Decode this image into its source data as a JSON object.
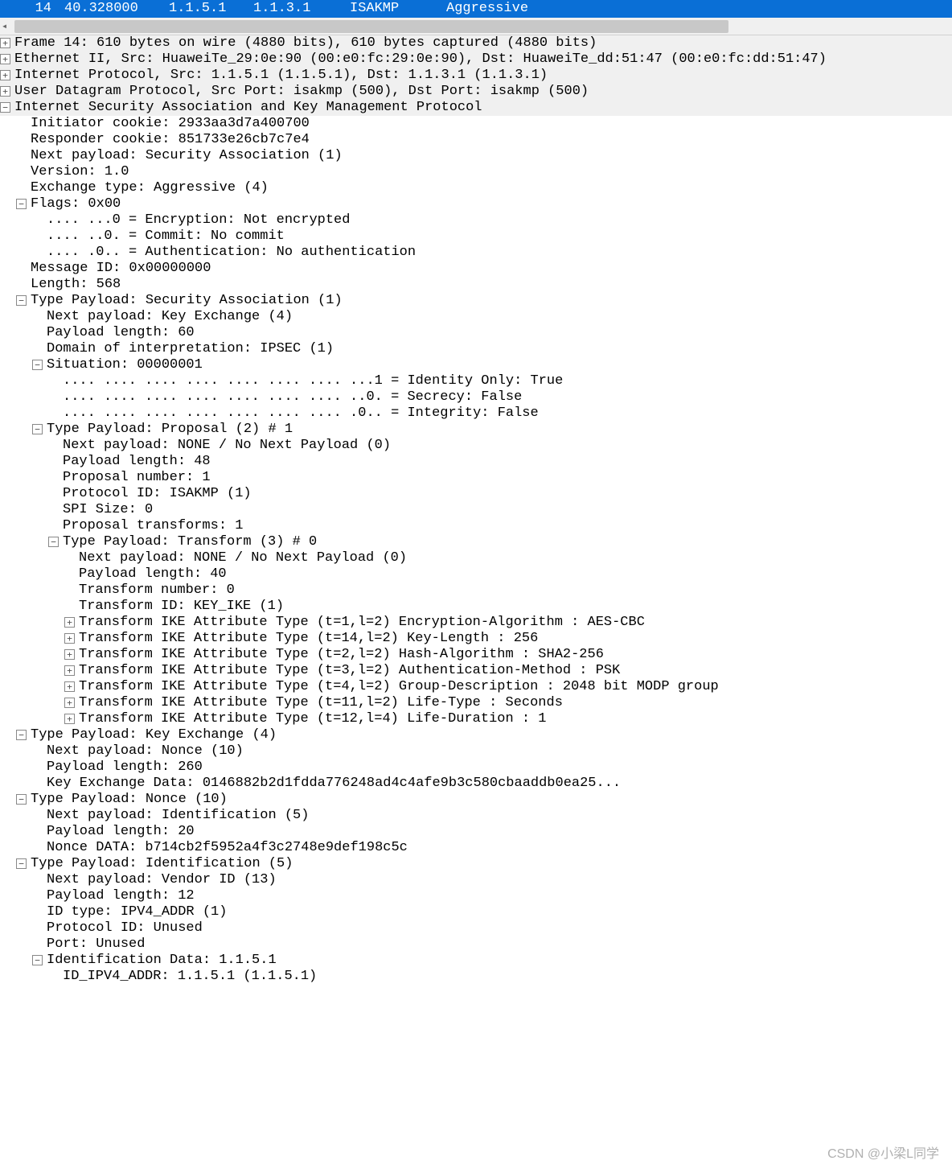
{
  "packet_row": {
    "num": "14",
    "time": "40.328000",
    "src": "1.1.5.1",
    "dst": "1.1.3.1",
    "proto": "ISAKMP",
    "info": "Aggressive"
  },
  "toggles": {
    "plus": "+",
    "minus": "−",
    "box_plus": "⊞",
    "box_minus": "⊟"
  },
  "summary": {
    "frame": "Frame 14: 610 bytes on wire (4880 bits), 610 bytes captured (4880 bits)",
    "eth": "Ethernet II, Src: HuaweiTe_29:0e:90 (00:e0:fc:29:0e:90), Dst: HuaweiTe_dd:51:47 (00:e0:fc:dd:51:47)",
    "ip": "Internet Protocol, Src: 1.1.5.1 (1.1.5.1), Dst: 1.1.3.1 (1.1.3.1)",
    "udp": "User Datagram Protocol, Src Port: isakmp (500), Dst Port: isakmp (500)",
    "isakmp": "Internet Security Association and Key Management Protocol"
  },
  "isakmp": {
    "init_cookie": "Initiator cookie: 2933aa3d7a400700",
    "resp_cookie": "Responder cookie: 851733e26cb7c7e4",
    "next_payload": "Next payload: Security Association (1)",
    "version": "Version: 1.0",
    "exchange": "Exchange type: Aggressive (4)",
    "flags_hdr": "Flags: 0x00",
    "flags": {
      "enc": ".... ...0 = Encryption: Not encrypted",
      "commit": ".... ..0. = Commit: No commit",
      "auth": ".... .0.. = Authentication: No authentication"
    },
    "msgid": "Message ID: 0x00000000",
    "length": "Length: 568",
    "sa": {
      "hdr": "Type Payload: Security Association (1)",
      "next": "Next payload: Key Exchange (4)",
      "len": "Payload length: 60",
      "doi": "Domain of interpretation: IPSEC (1)",
      "situation_hdr": "Situation: 00000001",
      "situation": {
        "id_only": ".... .... .... .... .... .... .... ...1 = Identity Only: True",
        "secrecy": ".... .... .... .... .... .... .... ..0. = Secrecy: False",
        "integrity": ".... .... .... .... .... .... .... .0.. = Integrity: False"
      },
      "proposal": {
        "hdr": "Type Payload: Proposal (2) # 1",
        "next": "Next payload: NONE / No Next Payload  (0)",
        "len": "Payload length: 48",
        "num": "Proposal number: 1",
        "protoid": "Protocol ID: ISAKMP (1)",
        "spi": "SPI Size: 0",
        "transforms": "Proposal transforms: 1",
        "transform": {
          "hdr": "Type Payload: Transform (3) # 0",
          "next": "Next payload: NONE / No Next Payload  (0)",
          "len": "Payload length: 40",
          "num": "Transform number: 0",
          "id": "Transform ID: KEY_IKE (1)",
          "attrs": [
            "Transform IKE Attribute Type (t=1,l=2) Encryption-Algorithm : AES-CBC",
            "Transform IKE Attribute Type (t=14,l=2) Key-Length : 256",
            "Transform IKE Attribute Type (t=2,l=2) Hash-Algorithm : SHA2-256",
            "Transform IKE Attribute Type (t=3,l=2) Authentication-Method : PSK",
            "Transform IKE Attribute Type (t=4,l=2) Group-Description : 2048 bit MODP group",
            "Transform IKE Attribute Type (t=11,l=2) Life-Type : Seconds",
            "Transform IKE Attribute Type (t=12,l=4) Life-Duration : 1"
          ]
        }
      }
    },
    "ke": {
      "hdr": "Type Payload: Key Exchange (4)",
      "next": "Next payload: Nonce (10)",
      "len": "Payload length: 260",
      "data": "Key Exchange Data: 0146882b2d1fdda776248ad4c4afe9b3c580cbaaddb0ea25..."
    },
    "nonce": {
      "hdr": "Type Payload: Nonce (10)",
      "next": "Next payload: Identification (5)",
      "len": "Payload length: 20",
      "data": "Nonce DATA: b714cb2f5952a4f3c2748e9def198c5c"
    },
    "ident": {
      "hdr": "Type Payload: Identification (5)",
      "next": "Next payload: Vendor ID (13)",
      "len": "Payload length: 12",
      "idtype": "ID type: IPV4_ADDR (1)",
      "protoid": "Protocol ID: Unused",
      "port": "Port: Unused",
      "data_hdr": "Identification Data: 1.1.5.1",
      "addr": "ID_IPV4_ADDR: 1.1.5.1 (1.1.5.1)"
    }
  },
  "watermark": "CSDN @小梁L同学"
}
